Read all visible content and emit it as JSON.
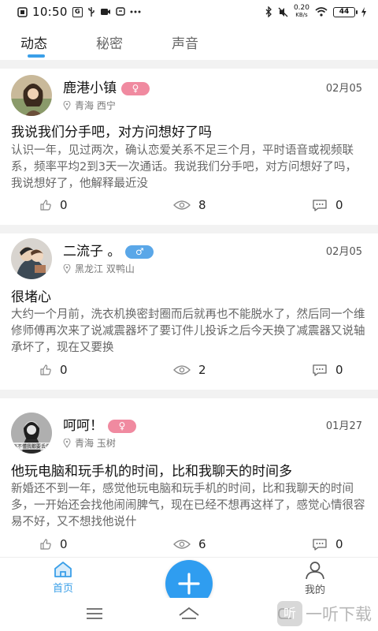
{
  "status_bar": {
    "time": "10:50",
    "net_speed_value": "0.20",
    "net_speed_unit": "KB/s",
    "battery": "44"
  },
  "tabs": [
    {
      "label": "动态",
      "active": true
    },
    {
      "label": "秘密",
      "active": false
    },
    {
      "label": "声音",
      "active": false
    }
  ],
  "posts": [
    {
      "username": "鹿港小镇",
      "gender": "female",
      "gender_symbol": "♀",
      "location": "青海 西宁",
      "date": "02月05",
      "title": "我说我们分手吧，对方问想好了吗",
      "body": "认识一年，见过两次，确认恋爱关系不足三个月，平时语音或视频联系，频率平均2到3天一次通话。我说我们分手吧，对方问想好了吗，我说想好了，他解释最近没",
      "likes": "0",
      "views": "8",
      "comments": "0"
    },
    {
      "username": "二流子 。",
      "gender": "male",
      "gender_symbol": "♂",
      "location": "黑龙江 双鸭山",
      "date": "02月05",
      "title": "很堵心",
      "body": "大约一个月前，洗衣机换密封圈而后就再也不能脱水了，然后同一个维修师傅再次来了说减震器坏了要订件儿投诉之后今天换了减震器又说轴承坏了，现在又要换",
      "likes": "0",
      "views": "2",
      "comments": "0"
    },
    {
      "username": "呵呵！",
      "gender": "female",
      "gender_symbol": "♀",
      "location": "青海 玉树",
      "date": "01月27",
      "title": "他玩电脑和玩手机的时间，比和我聊天的时间多",
      "body": "新婚还不到一年，感觉他玩电脑和玩手机的时间，比和我聊天的时间多，一开始还会找他闹闹脾气，现在已经不想再这样了，感觉心情很容易不好，又不想找他说什",
      "likes": "0",
      "views": "6",
      "comments": "0",
      "avatar_caption": "再不懂我都要丢偿"
    }
  ],
  "bottom_nav": {
    "home_label": "首页",
    "mine_label": "我的"
  },
  "watermark": {
    "text": "一听下载",
    "logo_glyph": "听"
  },
  "colors": {
    "accent": "#2f9df0",
    "tab_indicator": "#3a9fe8",
    "female_badge": "#f08aa0",
    "male_badge": "#5aa7e8",
    "separator": "#f2f2f2"
  }
}
